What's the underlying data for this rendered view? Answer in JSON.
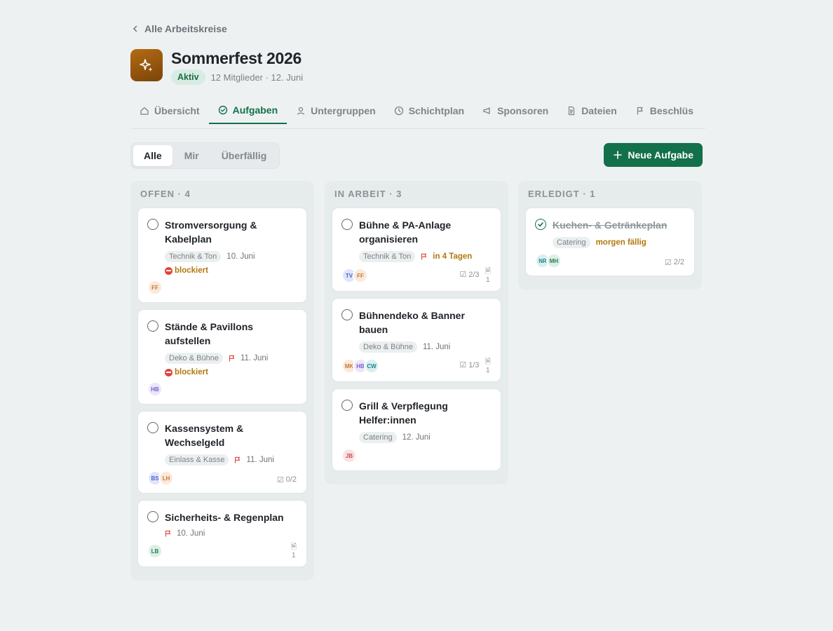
{
  "back_label": "Alle Arbeitskreise",
  "project": {
    "title": "Sommerfest 2026",
    "status": "Aktiv",
    "meta": "12 Mitglieder · 12. Juni"
  },
  "tabs": [
    {
      "label": "Übersicht",
      "icon": "home-icon"
    },
    {
      "label": "Aufgaben",
      "icon": "check-circle-icon",
      "active": true
    },
    {
      "label": "Untergruppen",
      "icon": "person-icon"
    },
    {
      "label": "Schichtplan",
      "icon": "clock-icon"
    },
    {
      "label": "Sponsoren",
      "icon": "megaphone-icon"
    },
    {
      "label": "Dateien",
      "icon": "document-icon"
    },
    {
      "label": "Beschlüs",
      "icon": "flag-icon"
    }
  ],
  "filters": [
    "Alle",
    "Mir",
    "Überfällig"
  ],
  "new_task_label": "Neue Aufgabe",
  "colors": {
    "accent": "#12704a",
    "warning": "#b2780c",
    "flag": "#d9453e"
  },
  "columns": [
    {
      "title": "OFFEN · 4",
      "cards": [
        {
          "title": "Stromversorgung & Kabelplan",
          "tag": "Technik & Ton",
          "flag": false,
          "date": "10. Juni",
          "blocked": "blockiert",
          "avatars": [
            {
              "initials": "FF",
              "bg": "#fbe9da",
              "fg": "#c27a3a"
            }
          ],
          "subtasks": "",
          "files": ""
        },
        {
          "title": "Stände & Pavillons aufstellen",
          "tag": "Deko & Bühne",
          "flag": true,
          "date": "11. Juni",
          "blocked": "blockiert",
          "avatars": [
            {
              "initials": "HB",
              "bg": "#ece6fb",
              "fg": "#7a5ed0"
            }
          ],
          "subtasks": "",
          "files": ""
        },
        {
          "title": "Kassensystem & Wechselgeld",
          "tag": "Einlass & Kasse",
          "flag": true,
          "date": "11. Juni",
          "blocked": "",
          "avatars": [
            {
              "initials": "BS",
              "bg": "#dfe6fb",
              "fg": "#4a62c9"
            },
            {
              "initials": "LH",
              "bg": "#fbe9da",
              "fg": "#c27a3a"
            }
          ],
          "subtasks": "0/2",
          "files": ""
        },
        {
          "title": "Sicherheits- & Regenplan",
          "tag": "",
          "flag": true,
          "date": "10. Juni",
          "blocked": "",
          "avatars": [
            {
              "initials": "LB",
              "bg": "#dcefe5",
              "fg": "#2a7d55"
            }
          ],
          "subtasks": "",
          "files": "1"
        }
      ]
    },
    {
      "title": "IN ARBEIT · 3",
      "cards": [
        {
          "title": "Bühne & PA-Anlage organisieren",
          "tag": "Technik & Ton",
          "flag": true,
          "date": "",
          "due": "in 4 Tagen",
          "blocked": "",
          "avatars": [
            {
              "initials": "TV",
              "bg": "#dfe6fb",
              "fg": "#4a62c9"
            },
            {
              "initials": "FF",
              "bg": "#fbe9da",
              "fg": "#c27a3a"
            }
          ],
          "subtasks": "2/3",
          "files": "1"
        },
        {
          "title": "Bühnendeko & Banner bauen",
          "tag": "Deko & Bühne",
          "flag": false,
          "date": "11. Juni",
          "blocked": "",
          "avatars": [
            {
              "initials": "MK",
              "bg": "#fbe9da",
              "fg": "#c27a3a"
            },
            {
              "initials": "HB",
              "bg": "#ece6fb",
              "fg": "#7a5ed0"
            },
            {
              "initials": "CW",
              "bg": "#d9eff0",
              "fg": "#21808a"
            }
          ],
          "subtasks": "1/3",
          "files": "1"
        },
        {
          "title": "Grill & Verpflegung Helfer:innen",
          "tag": "Catering",
          "flag": false,
          "date": "12. Juni",
          "blocked": "",
          "avatars": [
            {
              "initials": "JB",
              "bg": "#fbe3e3",
              "fg": "#c84a4a"
            }
          ],
          "subtasks": "",
          "files": ""
        }
      ]
    },
    {
      "title": "ERLEDIGT · 1",
      "cards": [
        {
          "title": "Kuchen- & Getränkeplan",
          "done": true,
          "tag": "Catering",
          "flag": false,
          "date": "",
          "due": "morgen fällig",
          "blocked": "",
          "avatars": [
            {
              "initials": "NR",
              "bg": "#d9eff0",
              "fg": "#21808a"
            },
            {
              "initials": "MH",
              "bg": "#dcefe5",
              "fg": "#2a7d55"
            }
          ],
          "subtasks": "2/2",
          "files": ""
        }
      ]
    }
  ]
}
